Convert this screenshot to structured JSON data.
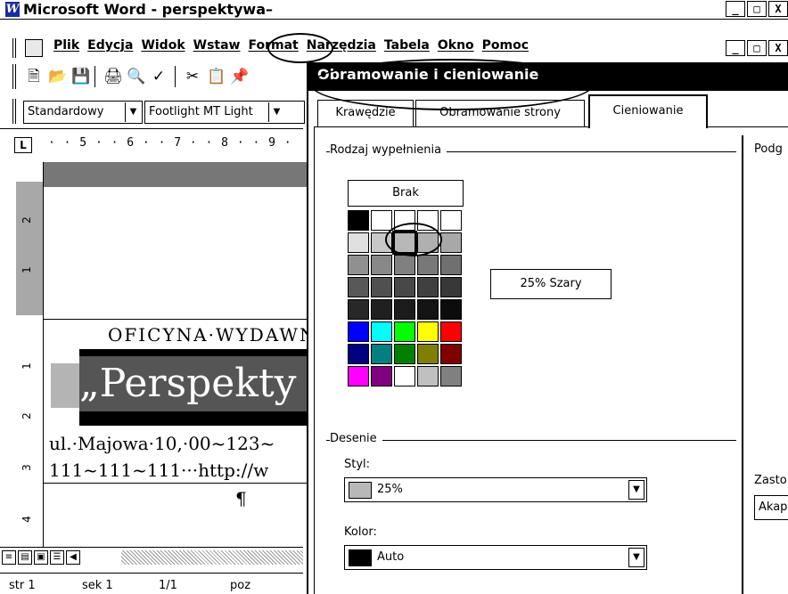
{
  "word": {
    "title": "Microsoft Word - perspektywa–",
    "logo": "W",
    "window_buttons": [
      "_",
      "□",
      "X"
    ],
    "menu": [
      "Plik",
      "Edycja",
      "Widok",
      "Wstaw",
      "Format",
      "Narzędzia",
      "Tabela",
      "Okno",
      "Pomoc"
    ],
    "toolbar_icons": [
      "new-icon",
      "open-icon",
      "save-icon",
      "print-icon",
      "print-preview-icon",
      "spelling-icon",
      "cut-icon",
      "copy-icon",
      "paste-icon"
    ],
    "style_combo": "Standardowy",
    "font_combo": "Footlight MT Light",
    "ruler_tab": "L",
    "ruler_scale": "· · 5 · · 6 · · 7 · · 8 · · 9 ·",
    "vruler_numbers": [
      "2",
      "1",
      "1",
      "2",
      "3",
      "4"
    ],
    "document": {
      "oficyna": "OFICYNA·WYDAWN",
      "perspektywa": "„Perspekty",
      "addr_line1": "ul.·Majowa·10,·00~123~",
      "addr_line2": "111~111~111···http://w",
      "pilcrow": "¶"
    },
    "status": {
      "page": "str 1",
      "section": "sek 1",
      "pages": "1/1",
      "position": "poz"
    }
  },
  "dialog": {
    "title": "Obramowanie i cieniowanie",
    "tabs": [
      "Krawędzie",
      "Obramowanie strony",
      "Cieniowanie"
    ],
    "active_tab": "Cieniowanie",
    "fill_group": "Rodzaj wypełnienia",
    "none_button": "Brak",
    "selected_fill": "25% Szary",
    "swatch_colors": [
      "#000000",
      "#ffffff",
      "#ffffff",
      "#ffffff",
      "#ffffff",
      "#e0e0e0",
      "#c8c8c8",
      "#b8b8b8",
      "#b0b0b0",
      "#a8a8a8",
      "#909090",
      "#888888",
      "#808080",
      "#787878",
      "#707070",
      "#585858",
      "#505050",
      "#484848",
      "#404040",
      "#383838",
      "#282828",
      "#202020",
      "#1c1c1c",
      "#141414",
      "#0c0c0c",
      "#0000ff",
      "#00ffff",
      "#00ff00",
      "#ffff00",
      "#ff0000",
      "#000080",
      "#008080",
      "#008000",
      "#808000",
      "#800000",
      "#ff00ff",
      "#800080",
      "#ffffff",
      "#c0c0c0",
      "#808080"
    ],
    "patterns_group": "Desenie",
    "style_label": "Styl:",
    "style_value": "25%",
    "style_chip_color": "#b8b8b8",
    "color_label": "Kolor:",
    "color_value": "Auto",
    "color_chip_color": "#000000",
    "preview_label": "Podg",
    "apply_label": "Zasto",
    "apply_value": "Akap"
  }
}
